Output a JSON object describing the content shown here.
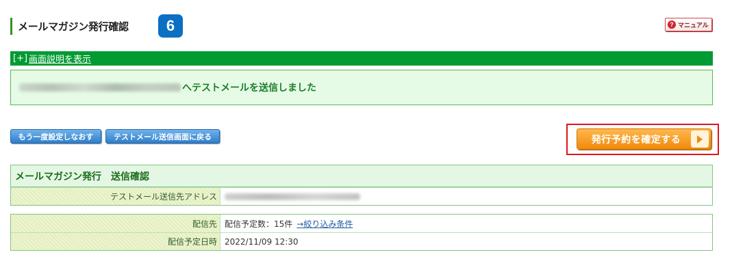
{
  "header": {
    "title": "メールマガジン発行確認",
    "step_number": "6",
    "manual_label": "マニュアル"
  },
  "help_bar": {
    "bracket": "[+]",
    "link_text": "画面説明を表示"
  },
  "message": {
    "suffix": "へテストメールを送信しました"
  },
  "buttons": {
    "redo_label": "もう一度設定しなおす",
    "back_label": "テストメール送信画面に戻る",
    "confirm_label": "発行予約を確定する"
  },
  "panel_send": {
    "title": "メールマガジン発行　送信確認",
    "rows": [
      {
        "label": "テストメール送信先アドレス"
      }
    ]
  },
  "panel_delivery": {
    "rows": [
      {
        "label": "配信先",
        "value": "配信予定数：15件",
        "link": "→絞り込み条件"
      },
      {
        "label": "配信予定日時",
        "value": "2022/11/09 12:30"
      }
    ]
  },
  "colors": {
    "green_bar": "#009b32",
    "badge_blue": "#0b6fc4",
    "confirm_orange": "#f08a0a",
    "highlight_red": "#e0141a"
  }
}
